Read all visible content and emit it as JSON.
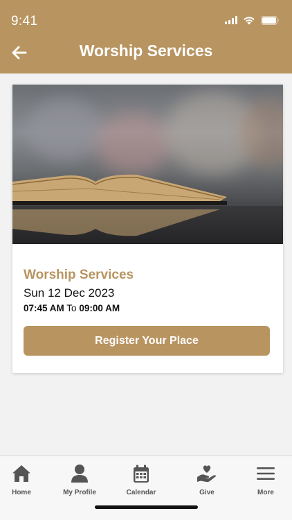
{
  "status_bar": {
    "time": "9:41"
  },
  "header": {
    "title": "Worship Services",
    "back_icon": "arrow-left-icon"
  },
  "event": {
    "title": "Worship Services",
    "date": "Sun 12 Dec 2023",
    "start_time": "07:45 AM",
    "to_label": "To",
    "end_time": "09:00 AM",
    "register_label": "Register Your Place"
  },
  "tabbar": {
    "items": [
      {
        "label": "Home",
        "icon": "home-icon"
      },
      {
        "label": "My Profile",
        "icon": "user-icon"
      },
      {
        "label": "Calendar",
        "icon": "calendar-icon"
      },
      {
        "label": "Give",
        "icon": "hand-heart-icon"
      },
      {
        "label": "More",
        "icon": "menu-icon"
      }
    ]
  },
  "colors": {
    "brand": "#b89460",
    "tab_icon": "#555555"
  }
}
